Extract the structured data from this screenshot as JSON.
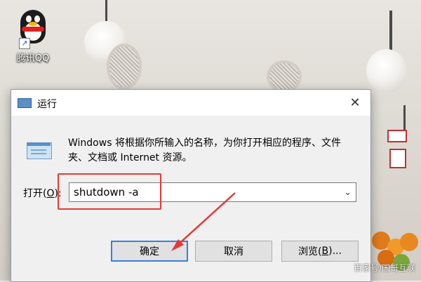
{
  "desktop": {
    "icon_label": "腾讯QQ",
    "shortcut_glyph": "↗"
  },
  "dialog": {
    "title": "运行",
    "close_glyph": "✕",
    "description": "Windows 将根据你所输入的名称，为你打开相应的程序、文件夹、文档或 Internet 资源。",
    "open_label": "打开(",
    "open_hotkey": "O",
    "open_label_end": "):",
    "command_value": "shutdown -a",
    "dropdown_glyph": "⌄",
    "ok_label": "确定",
    "cancel_label": "取消",
    "browse_label": "浏览(",
    "browse_hotkey": "B",
    "browse_label_end": ")..."
  },
  "watermark": "百家号/国哥互联",
  "colors": {
    "highlight": "#e53935",
    "ok_border": "#3c7fd8"
  }
}
